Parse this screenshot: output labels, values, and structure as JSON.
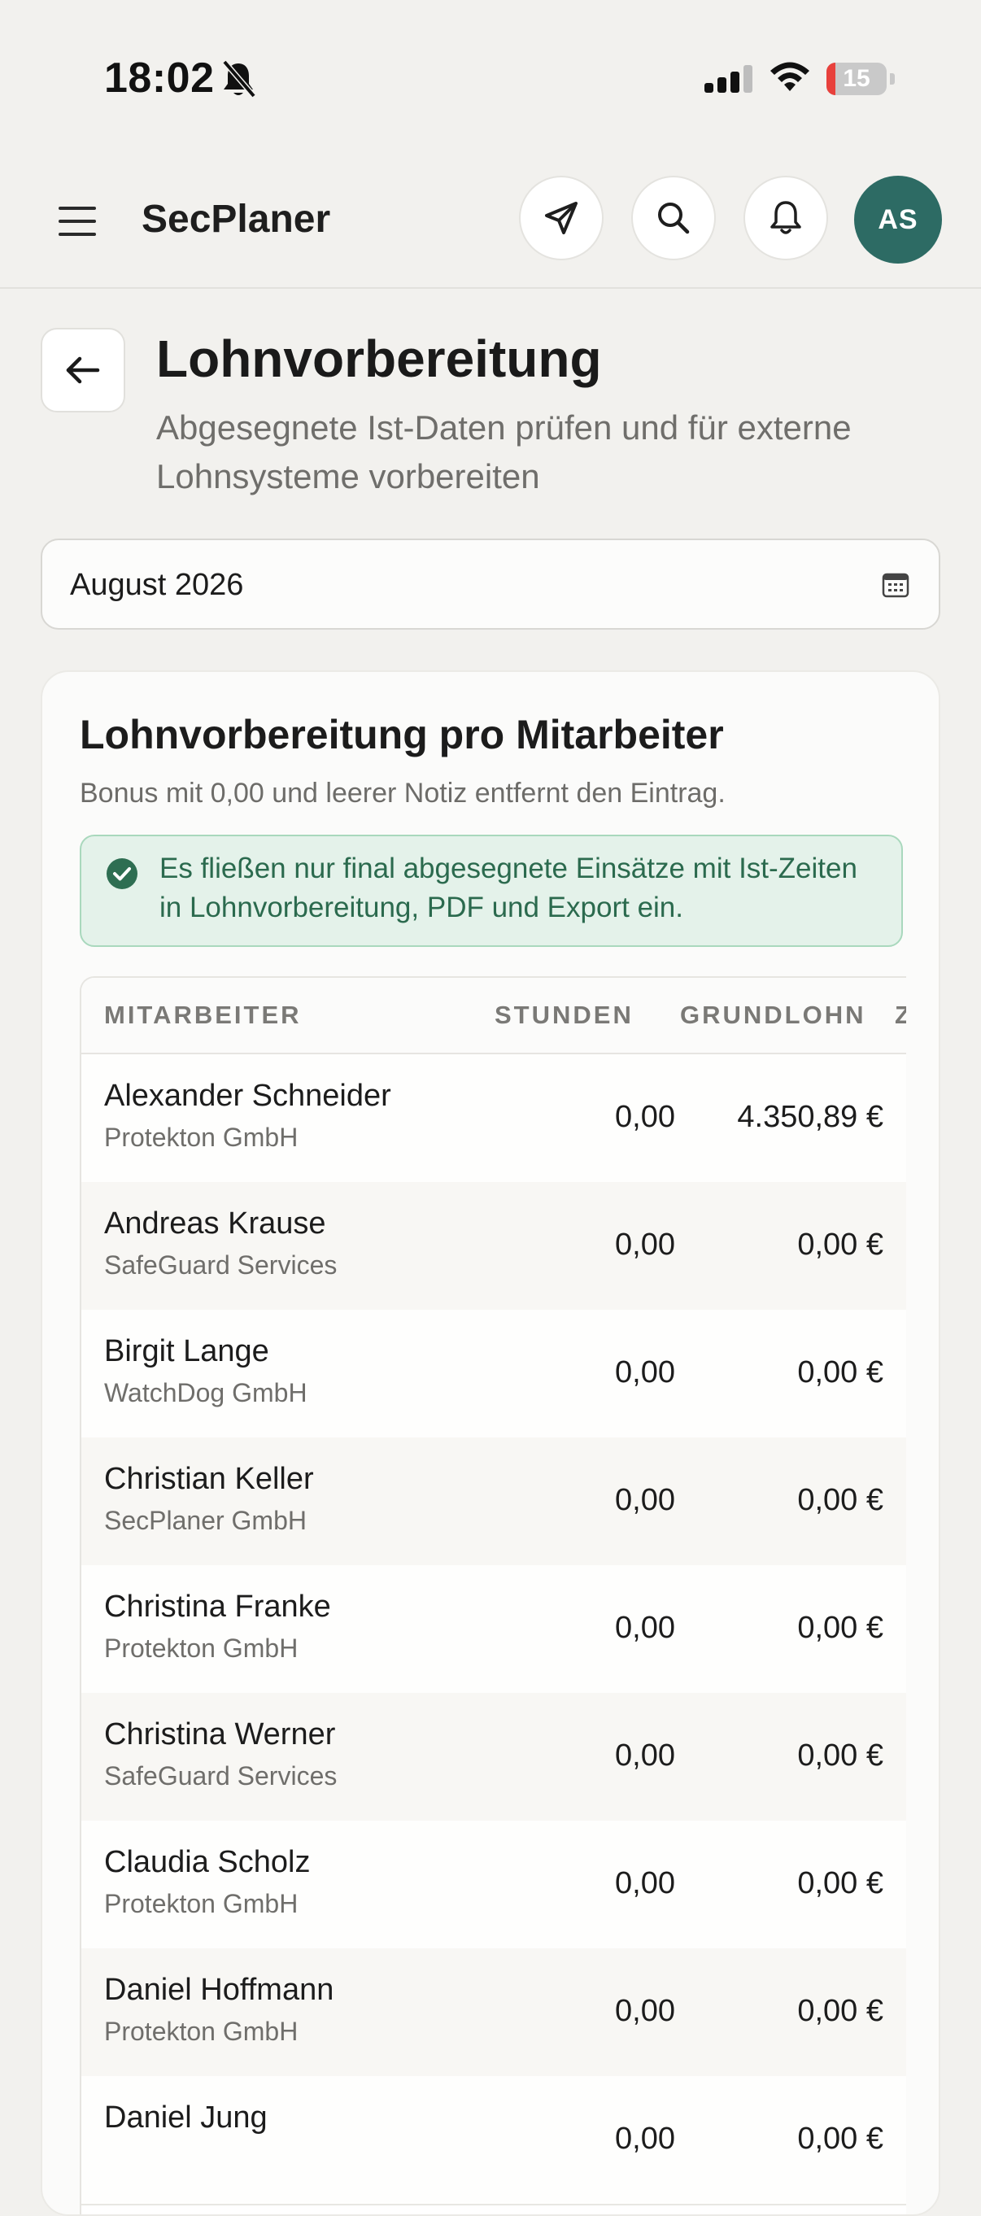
{
  "status_bar": {
    "time": "18:02",
    "battery": "15",
    "battery_level": 0.15
  },
  "header": {
    "app_title": "SecPlaner",
    "avatar_initials": "AS"
  },
  "page": {
    "title": "Lohnvorbereitung",
    "subtitle": "Abgesegnete Ist-Daten prüfen und für externe Lohnsysteme vorbereiten",
    "month_value": "August 2026"
  },
  "card": {
    "title": "Lohnvorbereitung pro Mitarbeiter",
    "hint": "Bonus mit 0,00 und leerer Notiz entfernt den Eintrag.",
    "info": "Es fließen nur final abgesegnete Einsätze mit Ist-Zeiten in Lohnvorbereitung, PDF und Export ein."
  },
  "table": {
    "columns": [
      "MITARBEITER",
      "STUNDEN",
      "GRUNDLOHN",
      "Z"
    ],
    "rows": [
      {
        "name": "Alexander Schneider",
        "company": "Protekton GmbH",
        "hours": "0,00",
        "base_pay": "4.350,89 €"
      },
      {
        "name": "Andreas Krause",
        "company": "SafeGuard Services",
        "hours": "0,00",
        "base_pay": "0,00 €"
      },
      {
        "name": "Birgit Lange",
        "company": "WatchDog GmbH",
        "hours": "0,00",
        "base_pay": "0,00 €"
      },
      {
        "name": "Christian Keller",
        "company": "SecPlaner GmbH",
        "hours": "0,00",
        "base_pay": "0,00 €"
      },
      {
        "name": "Christina Franke",
        "company": "Protekton GmbH",
        "hours": "0,00",
        "base_pay": "0,00 €"
      },
      {
        "name": "Christina Werner",
        "company": "SafeGuard Services",
        "hours": "0,00",
        "base_pay": "0,00 €"
      },
      {
        "name": "Claudia Scholz",
        "company": "Protekton GmbH",
        "hours": "0,00",
        "base_pay": "0,00 €"
      },
      {
        "name": "Daniel Hoffmann",
        "company": "Protekton GmbH",
        "hours": "0,00",
        "base_pay": "0,00 €"
      },
      {
        "name": "Daniel Jung",
        "company": "",
        "hours": "0,00",
        "base_pay": "0,00 €"
      }
    ]
  },
  "icons": {
    "menu": "menu-icon",
    "send": "send-icon",
    "search": "search-icon",
    "bell": "bell-icon",
    "back": "arrow-left-icon",
    "calendar": "calendar-icon",
    "check": "check-circle-icon"
  },
  "colors": {
    "accent": "#2d6b64",
    "info_bg": "#e4f2ea",
    "info_text": "#2b6a4e",
    "battery_low": "#e8413c"
  }
}
